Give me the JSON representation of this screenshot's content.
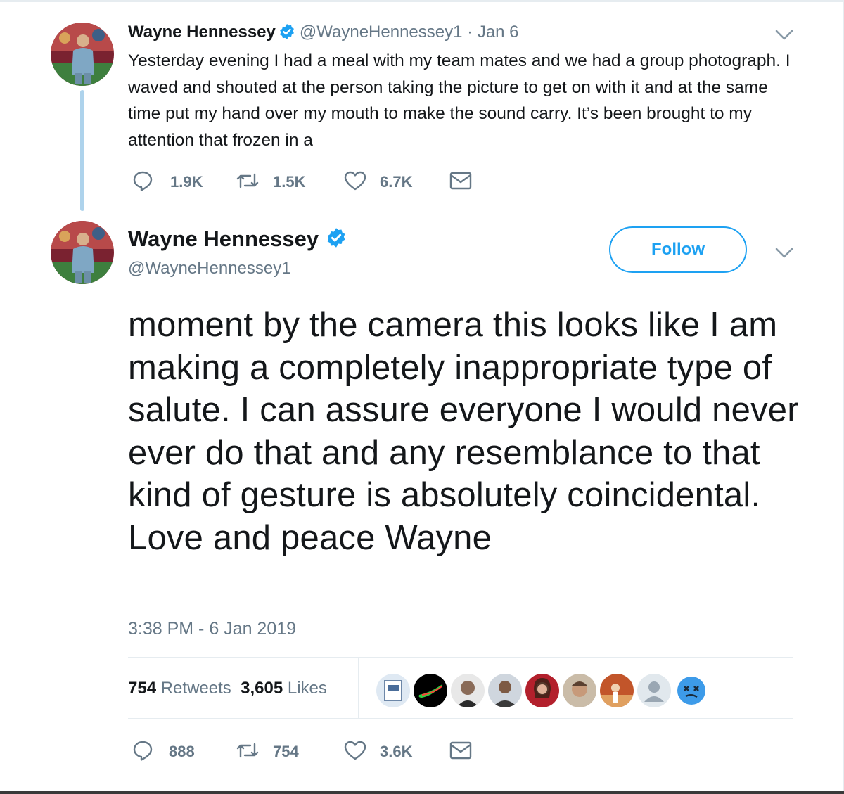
{
  "thread_tweet": {
    "name": "Wayne Hennessey",
    "handle": "@WayneHennessey1",
    "separator": "·",
    "date": "Jan 6",
    "text": "Yesterday evening I had a meal with my team mates and we had a group photograph. I waved and shouted at the person taking the picture to get on with it and at the same time put my hand over my mouth to make the sound carry. It’s been brought to my attention that frozen in a",
    "actions": {
      "replies": "1.9K",
      "retweets": "1.5K",
      "likes": "6.7K"
    },
    "icons": [
      "avatar",
      "verified-badge-icon",
      "chevron-down-icon",
      "reply-icon",
      "retweet-icon",
      "like-heart-icon",
      "direct-message-icon"
    ]
  },
  "main_tweet": {
    "name": "Wayne Hennessey",
    "handle": "@WayneHennessey1",
    "follow_label": "Follow",
    "text": "moment by the camera this looks like I am making a completely inappropriate type of salute. I can assure everyone I would  never ever do that and any resemblance to that kind of gesture is absolutely coincidental. Love and peace Wayne",
    "timestamp": "3:38 PM - 6 Jan 2019",
    "stats": {
      "retweets_count": "754",
      "retweets_label": "Retweets",
      "likes_count": "3,605",
      "likes_label": "Likes"
    },
    "actions": {
      "replies": "888",
      "retweets": "754",
      "likes": "3.6K"
    }
  },
  "colors": {
    "accent": "#1da1f2",
    "muted_text": "#657786",
    "thread_line": "#aed3ec",
    "divider": "#e6ecf0"
  }
}
